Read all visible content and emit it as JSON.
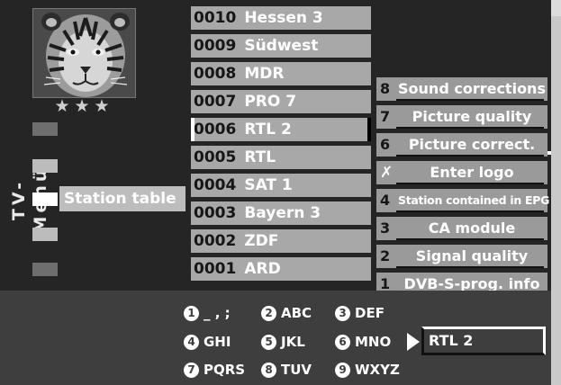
{
  "menu_title": "TV-Menü",
  "rating_stars": "★★★",
  "sidebar": {
    "selected_label": "Station table"
  },
  "stations": [
    {
      "num": "0010",
      "name": "Hessen 3"
    },
    {
      "num": "0009",
      "name": "Südwest"
    },
    {
      "num": "0008",
      "name": "MDR"
    },
    {
      "num": "0007",
      "name": "PRO 7"
    },
    {
      "num": "0006",
      "name": "RTL 2",
      "selected": true
    },
    {
      "num": "0005",
      "name": "RTL"
    },
    {
      "num": "0004",
      "name": "SAT 1"
    },
    {
      "num": "0003",
      "name": "Bayern 3"
    },
    {
      "num": "0002",
      "name": "ZDF"
    },
    {
      "num": "0001",
      "name": "ARD"
    }
  ],
  "options": [
    {
      "num": "8",
      "label": "Sound corrections"
    },
    {
      "num": "7",
      "label": "Picture quality"
    },
    {
      "num": "6",
      "label": "Picture correct."
    },
    {
      "num": "✗",
      "label": "Enter logo",
      "selected": true
    },
    {
      "num": "4",
      "label": "Station contained in EPG"
    },
    {
      "num": "3",
      "label": "CA module"
    },
    {
      "num": "2",
      "label": "Signal quality"
    },
    {
      "num": "1",
      "label": "DVB-S-prog. info"
    }
  ],
  "keypad": [
    {
      "key": "1",
      "chars": "_ , ;"
    },
    {
      "key": "2",
      "chars": "ABC"
    },
    {
      "key": "3",
      "chars": "DEF"
    },
    {
      "key": "4",
      "chars": "GHI"
    },
    {
      "key": "5",
      "chars": "JKL"
    },
    {
      "key": "6",
      "chars": "MNO"
    },
    {
      "key": "7",
      "chars": "PQRS"
    },
    {
      "key": "8",
      "chars": "TUV"
    },
    {
      "key": "9",
      "chars": "WXYZ"
    }
  ],
  "logo_entry": {
    "value": "RTL 2"
  },
  "colors": {
    "screen_bg": "#252525",
    "panel_bg": "#3e3e3e",
    "row_bg": "#a8a8a8",
    "text": "#ffffff"
  }
}
